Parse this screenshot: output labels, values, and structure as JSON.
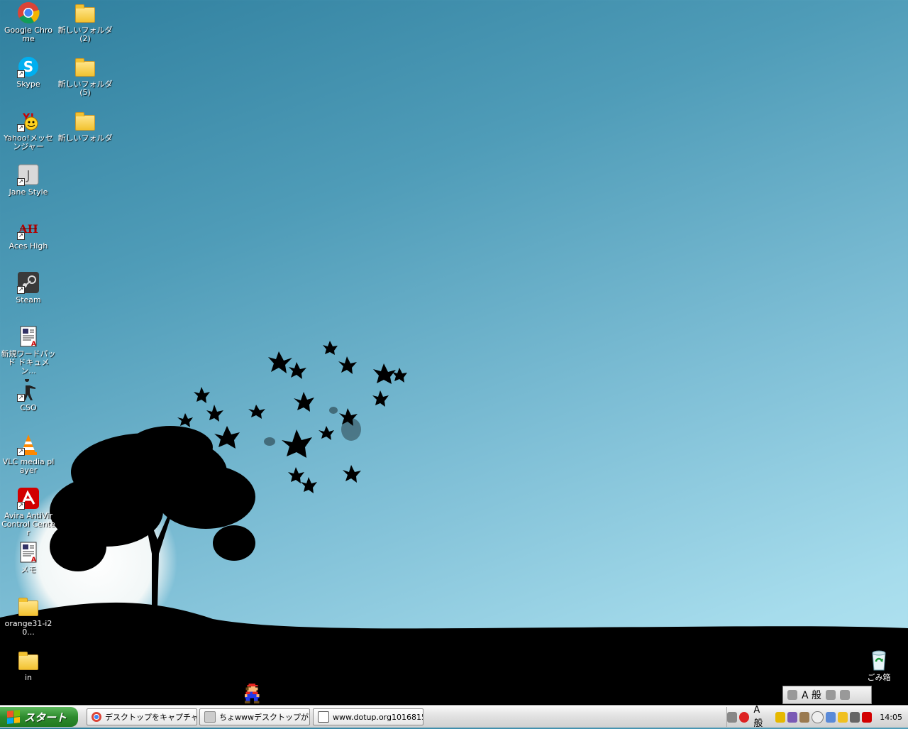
{
  "desktop_icons": [
    {
      "name": "google-chrome-icon",
      "label": "Google Chrome",
      "type": "chrome"
    },
    {
      "name": "skype-icon",
      "label": "Skype",
      "type": "skype"
    },
    {
      "name": "yahoo-messenger-icon",
      "label": "Yahoo!メッセンジャー",
      "type": "yahoo"
    },
    {
      "name": "jane-style-icon",
      "label": "Jane Style",
      "type": "jane"
    },
    {
      "name": "aces-high-icon",
      "label": "Aces High",
      "type": "aces"
    },
    {
      "name": "steam-icon",
      "label": "Steam",
      "type": "steam"
    },
    {
      "name": "wordpad-document-icon",
      "label": "新規ワードパッド ドキュメン...",
      "type": "doc"
    },
    {
      "name": "cso-icon",
      "label": "CSO",
      "type": "cso"
    },
    {
      "name": "vlc-icon",
      "label": "VLC media player",
      "type": "vlc"
    },
    {
      "name": "avira-icon",
      "label": "Avira AntiVir Control Center",
      "type": "avira"
    },
    {
      "name": "memo-icon",
      "label": "メモ",
      "type": "doc"
    },
    {
      "name": "folder-icon",
      "label": "orange31-i20...",
      "type": "folder"
    },
    {
      "name": "folder-icon",
      "label": "in",
      "type": "folder"
    }
  ],
  "folder_icons": [
    {
      "label": "新しいフォルダ (2)"
    },
    {
      "label": "新しいフォルダ (5)"
    },
    {
      "label": "新しいフォルダ"
    }
  ],
  "recycle_bin": {
    "label": "ごみ箱"
  },
  "taskbar": {
    "start_label": "スタート",
    "tasks": [
      {
        "label": "デスクトップをキャプチャ...",
        "icon": "chrome"
      },
      {
        "label": "ちょwwwデスクトップが...",
        "icon": "jane"
      },
      {
        "label": "www.dotup.org1016815",
        "icon": "window"
      }
    ],
    "tray_ime": "A 般",
    "clock": "14:05"
  },
  "language_bar": {
    "ime": "A 般"
  },
  "colors": {
    "start_green": "#2e8b2e",
    "sky_dark": "#2f7f9e",
    "sky_light": "#b9e6f2"
  }
}
